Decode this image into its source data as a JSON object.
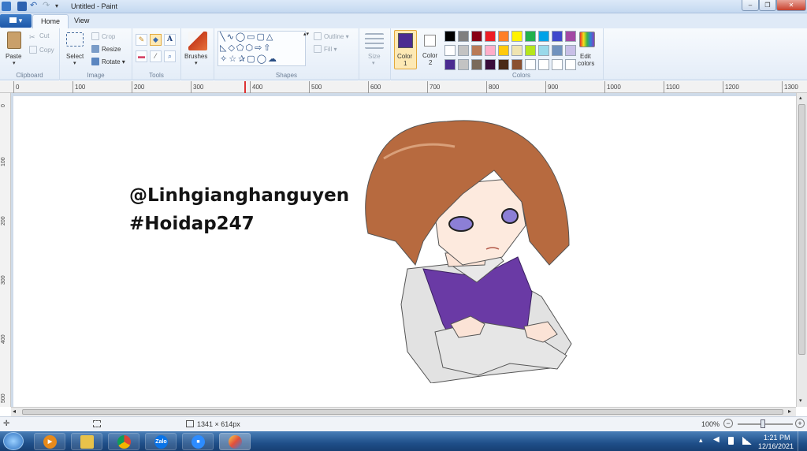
{
  "window": {
    "title": "Untitled - Paint",
    "controls": [
      "–",
      "❐",
      "✕"
    ]
  },
  "tabs": {
    "file": "▾",
    "home": "Home",
    "view": "View"
  },
  "clipboard": {
    "paste": "Paste",
    "cut": "Cut",
    "copy": "Copy",
    "label": "Clipboard"
  },
  "image": {
    "select": "Select",
    "crop": "Crop",
    "resize": "Resize",
    "rotate": "Rotate",
    "label": "Image"
  },
  "tools": {
    "label": "Tools",
    "text_glyph": "A"
  },
  "brushes": {
    "label": "Brushes"
  },
  "shapes": {
    "label": "Shapes",
    "outline": "Outline",
    "fill": "Fill"
  },
  "size": {
    "label": "Size"
  },
  "color1": {
    "label": "Color",
    "num": "1",
    "value": "#4b2c91"
  },
  "color2": {
    "label": "Color",
    "num": "2",
    "value": "#ffffff"
  },
  "colors": {
    "label": "Colors",
    "edit_line1": "Edit",
    "edit_line2": "colors",
    "palette_row1": [
      "#000000",
      "#7f7f7f",
      "#880015",
      "#ed1c24",
      "#ff7f27",
      "#fff200",
      "#22b14c",
      "#00a2e8",
      "#3f48cc",
      "#a349a4"
    ],
    "palette_row2": [
      "#ffffff",
      "#c3c3c3",
      "#b97a57",
      "#ffaec9",
      "#ffc90e",
      "#efe4b0",
      "#b5e61d",
      "#99d9ea",
      "#7092be",
      "#c8bfe7"
    ],
    "palette_row3": [
      "#4b2c91",
      "#c3c3c3",
      "#7a6a5a",
      "#3a0d3a",
      "#4a2a16",
      "#8a5030",
      "#ffffff",
      "#ffffff",
      "#ffffff",
      "#ffffff"
    ]
  },
  "ruler": {
    "h_ticks": [
      "0",
      "100",
      "200",
      "300",
      "400",
      "500",
      "600",
      "700",
      "800",
      "900",
      "1000",
      "1100",
      "1200",
      "1300"
    ],
    "v_ticks": [
      "0",
      "100",
      "200",
      "300",
      "400",
      "500"
    ]
  },
  "drawing": {
    "line1": "@Linhgianghanguyen",
    "line2": "#Hoidap247"
  },
  "status": {
    "size": "1341 × 614px",
    "zoom": "100%"
  },
  "taskbar": {
    "apps": [
      "windows-media-player",
      "file-explorer",
      "chrome",
      "zalo",
      "zoom",
      "paint"
    ],
    "zalo_text": "Zalo",
    "time": "1:21 PM",
    "date": "12/16/2021"
  }
}
